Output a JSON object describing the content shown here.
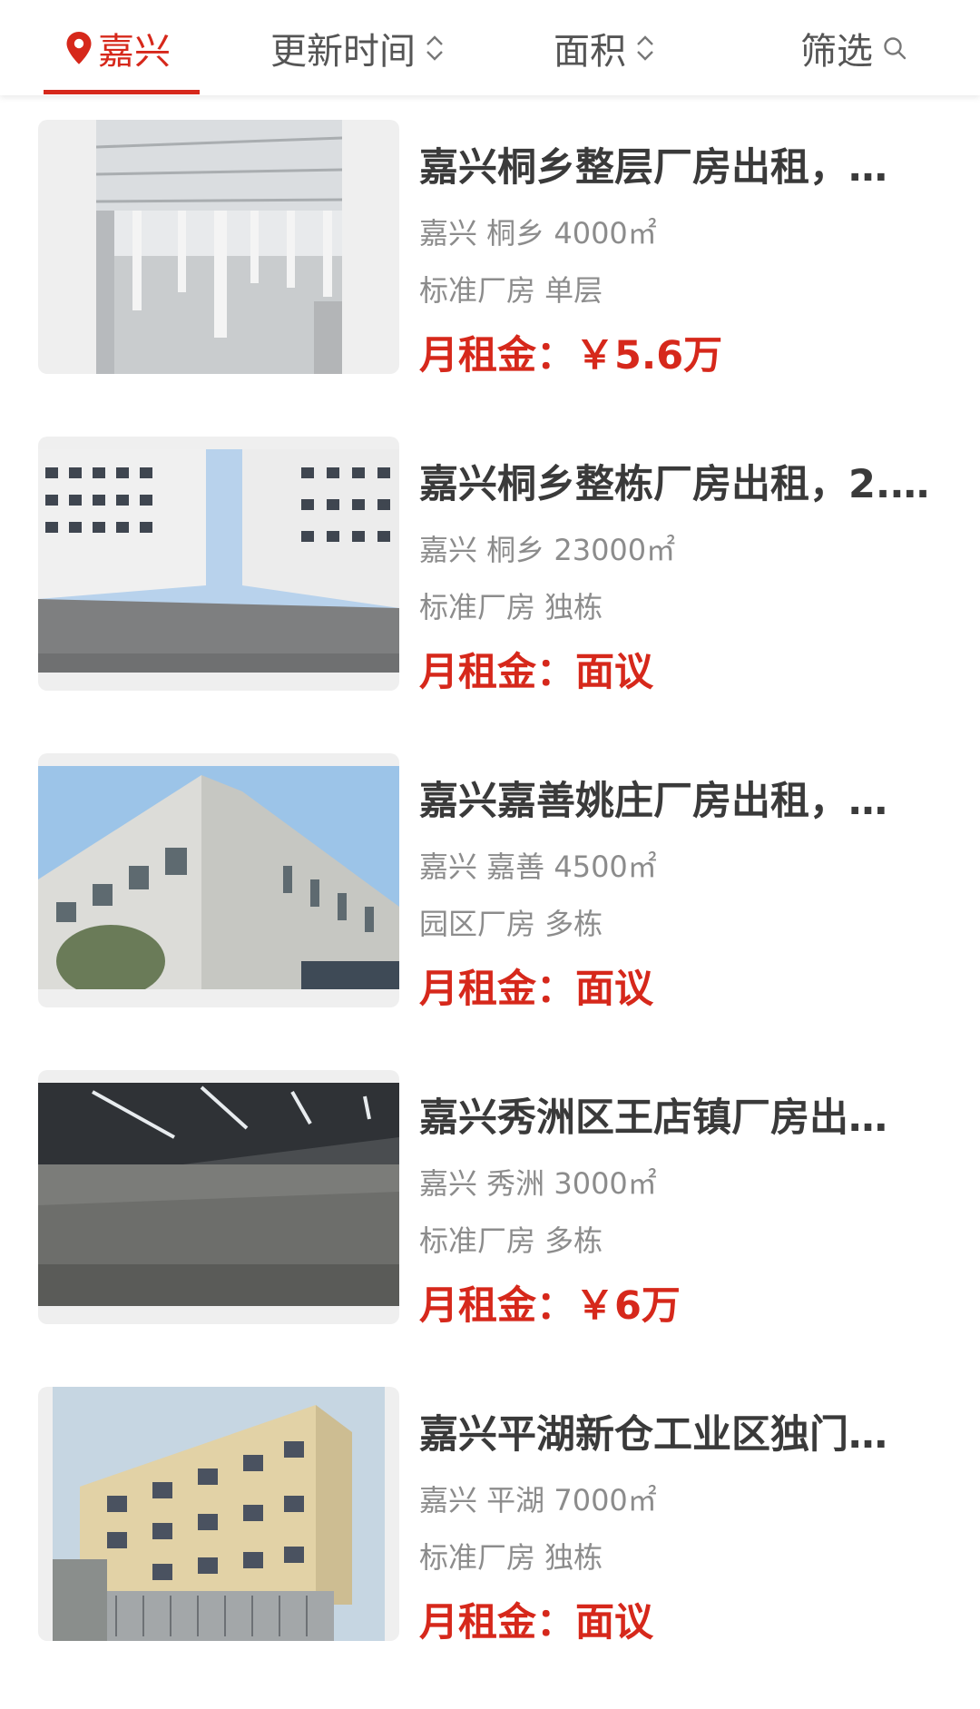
{
  "filter_bar": {
    "city": "嘉兴",
    "sort_update": "更新时间",
    "sort_area": "面积",
    "filter": "筛选"
  },
  "listings": [
    {
      "title": "嘉兴桐乡整层厂房出租，…",
      "location": "嘉兴 桐乡 4000㎡",
      "type": "标准厂房 单层",
      "price_label": "月租金：",
      "price": "￥5.6万"
    },
    {
      "title": "嘉兴桐乡整栋厂房出租，2.…",
      "location": "嘉兴 桐乡 23000㎡",
      "type": "标准厂房 独栋",
      "price_label": "月租金：",
      "price": "面议"
    },
    {
      "title": "嘉兴嘉善姚庄厂房出租，…",
      "location": "嘉兴 嘉善 4500㎡",
      "type": "园区厂房 多栋",
      "price_label": "月租金：",
      "price": "面议"
    },
    {
      "title": "嘉兴秀洲区王店镇厂房出…",
      "location": "嘉兴 秀洲 3000㎡",
      "type": "标准厂房 多栋",
      "price_label": "月租金：",
      "price": "￥6万"
    },
    {
      "title": "嘉兴平湖新仓工业区独门…",
      "location": "嘉兴 平湖 7000㎡",
      "type": "标准厂房 独栋",
      "price_label": "月租金：",
      "price": "面议"
    }
  ],
  "icons": {
    "location": "map-pin-icon",
    "sort": "sort-updown-icon",
    "search": "search-icon"
  },
  "colors": {
    "accent": "#d6281b",
    "title": "#3a3a3a",
    "meta": "#8c8c8c"
  }
}
